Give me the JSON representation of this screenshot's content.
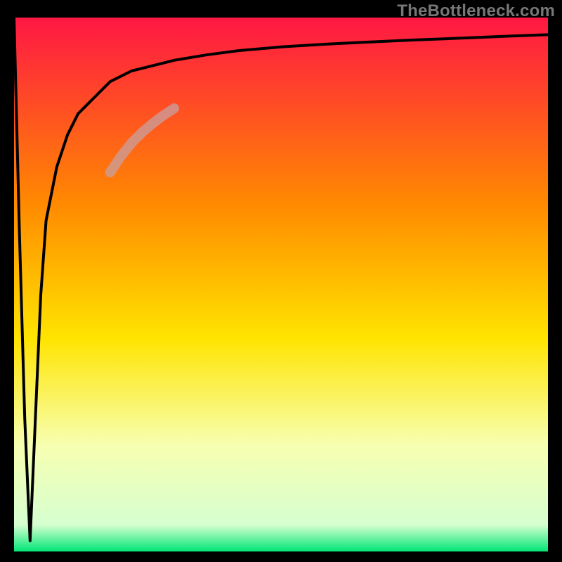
{
  "watermark": "TheBottleneck.com",
  "chart_data": {
    "type": "line",
    "title": "",
    "xlabel": "",
    "ylabel": "",
    "xlim": [
      0,
      100
    ],
    "ylim": [
      0,
      100
    ],
    "grid": false,
    "legend": false,
    "gradient_stops": [
      {
        "offset": 0.0,
        "color": "#ff1744"
      },
      {
        "offset": 0.35,
        "color": "#ff8a00"
      },
      {
        "offset": 0.6,
        "color": "#ffe400"
      },
      {
        "offset": 0.8,
        "color": "#f7ffb0"
      },
      {
        "offset": 0.95,
        "color": "#d6ffd0"
      },
      {
        "offset": 1.0,
        "color": "#00e676"
      }
    ],
    "series": [
      {
        "name": "bottleneck-curve",
        "x": [
          0,
          1,
          2,
          3,
          4,
          5,
          6,
          8,
          10,
          12,
          15,
          18,
          22,
          26,
          30,
          36,
          42,
          50,
          58,
          66,
          75,
          85,
          92,
          100
        ],
        "y": [
          100,
          60,
          25,
          2,
          25,
          48,
          62,
          72,
          78,
          82,
          85,
          88,
          90,
          91,
          92,
          93,
          93.8,
          94.5,
          95,
          95.4,
          95.8,
          96.2,
          96.5,
          96.8
        ]
      },
      {
        "name": "highlight-segment",
        "x": [
          18,
          20,
          22,
          24,
          26,
          28,
          30
        ],
        "y": [
          71,
          74,
          76.5,
          78.5,
          80.2,
          81.7,
          83
        ]
      }
    ],
    "annotations": []
  }
}
